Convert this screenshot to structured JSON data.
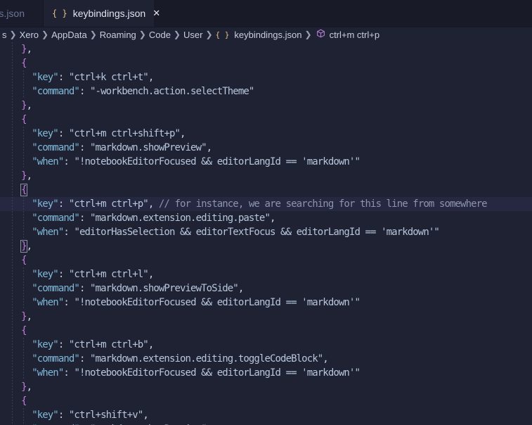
{
  "tabs": [
    {
      "label": "gs.json"
    },
    {
      "label": "keybindings.json",
      "icon": "{ }",
      "close": "✕"
    }
  ],
  "breadcrumb": {
    "items": [
      "s",
      "Xero",
      "AppData",
      "Roaming",
      "Code",
      "User"
    ],
    "file_icon": "{ }",
    "file": "keybindings.json",
    "symbol": "ctrl+m ctrl+p"
  },
  "code_lines": [
    [
      [
        "    },",
        "punct"
      ]
    ],
    [
      [
        "    {",
        "brace"
      ]
    ],
    [
      [
        "      ",
        "punct"
      ],
      [
        "\"key\"",
        "key"
      ],
      [
        ": ",
        "punct"
      ],
      [
        "\"ctrl+k ctrl+t\"",
        "str"
      ],
      [
        ",",
        "punct"
      ]
    ],
    [
      [
        "      ",
        "punct"
      ],
      [
        "\"command\"",
        "key"
      ],
      [
        ": ",
        "punct"
      ],
      [
        "\"-workbench.action.selectTheme\"",
        "str"
      ]
    ],
    [
      [
        "    },",
        "punct"
      ]
    ],
    [
      [
        "    {",
        "brace"
      ]
    ],
    [
      [
        "      ",
        "punct"
      ],
      [
        "\"key\"",
        "key"
      ],
      [
        ": ",
        "punct"
      ],
      [
        "\"ctrl+m ctrl+shift+p\"",
        "str"
      ],
      [
        ",",
        "punct"
      ]
    ],
    [
      [
        "      ",
        "punct"
      ],
      [
        "\"command\"",
        "key"
      ],
      [
        ": ",
        "punct"
      ],
      [
        "\"markdown.showPreview\"",
        "str"
      ],
      [
        ",",
        "punct"
      ]
    ],
    [
      [
        "      ",
        "punct"
      ],
      [
        "\"when\"",
        "key"
      ],
      [
        ": ",
        "punct"
      ],
      [
        "\"!notebookEditorFocused && editorLangId == 'markdown'\"",
        "str"
      ]
    ],
    [
      [
        "    },",
        "punct"
      ]
    ],
    [
      [
        "    {",
        "brace-match"
      ]
    ],
    [
      [
        "      ",
        "punct"
      ],
      [
        "\"key\"",
        "key"
      ],
      [
        ": ",
        "punct"
      ],
      [
        "\"ctrl+m ctrl+p\"",
        "str"
      ],
      [
        ", ",
        "punct"
      ],
      [
        "// for instance, we are searching for this line from somewhere",
        "comment"
      ]
    ],
    [
      [
        "      ",
        "punct"
      ],
      [
        "\"command\"",
        "key"
      ],
      [
        ": ",
        "punct"
      ],
      [
        "\"markdown.extension.editing.paste\"",
        "str"
      ],
      [
        ",",
        "punct"
      ]
    ],
    [
      [
        "      ",
        "punct"
      ],
      [
        "\"when\"",
        "key"
      ],
      [
        ": ",
        "punct"
      ],
      [
        "\"editorHasSelection && editorTextFocus && editorLangId == 'markdown'\"",
        "str"
      ]
    ],
    [
      [
        "    },",
        "brace-match-close"
      ]
    ],
    [
      [
        "    {",
        "brace"
      ]
    ],
    [
      [
        "      ",
        "punct"
      ],
      [
        "\"key\"",
        "key"
      ],
      [
        ": ",
        "punct"
      ],
      [
        "\"ctrl+m ctrl+l\"",
        "str"
      ],
      [
        ",",
        "punct"
      ]
    ],
    [
      [
        "      ",
        "punct"
      ],
      [
        "\"command\"",
        "key"
      ],
      [
        ": ",
        "punct"
      ],
      [
        "\"markdown.showPreviewToSide\"",
        "str"
      ],
      [
        ",",
        "punct"
      ]
    ],
    [
      [
        "      ",
        "punct"
      ],
      [
        "\"when\"",
        "key"
      ],
      [
        ": ",
        "punct"
      ],
      [
        "\"!notebookEditorFocused && editorLangId == 'markdown'\"",
        "str"
      ]
    ],
    [
      [
        "    },",
        "punct"
      ]
    ],
    [
      [
        "    {",
        "brace"
      ]
    ],
    [
      [
        "      ",
        "punct"
      ],
      [
        "\"key\"",
        "key"
      ],
      [
        ": ",
        "punct"
      ],
      [
        "\"ctrl+m ctrl+b\"",
        "str"
      ],
      [
        ",",
        "punct"
      ]
    ],
    [
      [
        "      ",
        "punct"
      ],
      [
        "\"command\"",
        "key"
      ],
      [
        ": ",
        "punct"
      ],
      [
        "\"markdown.extension.editing.toggleCodeBlock\"",
        "str"
      ],
      [
        ",",
        "punct"
      ]
    ],
    [
      [
        "      ",
        "punct"
      ],
      [
        "\"when\"",
        "key"
      ],
      [
        ": ",
        "punct"
      ],
      [
        "\"!notebookEditorFocused && editorLangId == 'markdown'\"",
        "str"
      ]
    ],
    [
      [
        "    },",
        "punct"
      ]
    ],
    [
      [
        "    {",
        "brace"
      ]
    ],
    [
      [
        "      ",
        "punct"
      ],
      [
        "\"key\"",
        "key"
      ],
      [
        ": ",
        "punct"
      ],
      [
        "\"ctrl+shift+v\"",
        "str"
      ],
      [
        ",",
        "punct"
      ]
    ],
    [
      [
        "      ",
        "punct"
      ],
      [
        "\"command\"",
        "key"
      ],
      [
        ": ",
        "punct"
      ],
      [
        "\"markdown.showPreview\"",
        "str"
      ],
      [
        ",",
        "punct"
      ]
    ]
  ],
  "colors": {
    "background": "#1f2233",
    "key": "#7fb8d8",
    "string": "#b7c6dc",
    "comment": "#8e94ad",
    "brace": "#c678dd"
  }
}
